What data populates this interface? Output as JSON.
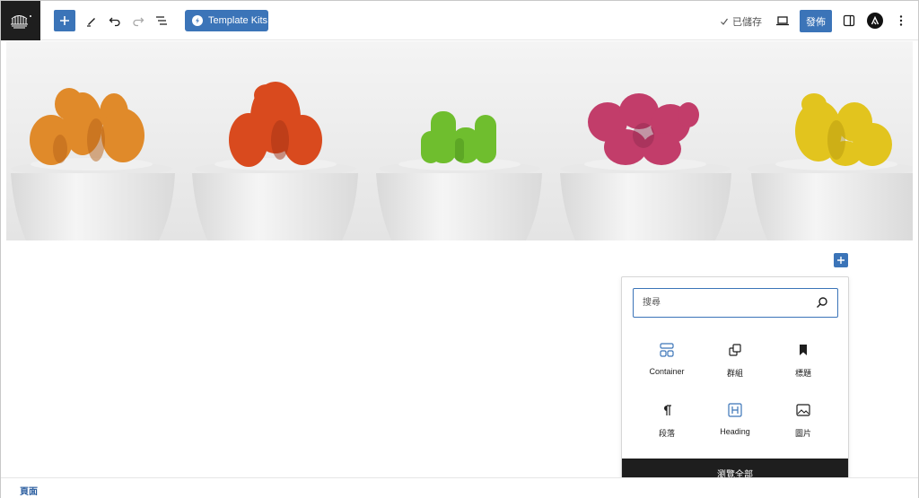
{
  "toolbar": {
    "template_kits_label": "Template Kits",
    "saved_label": "已儲存",
    "publish_label": "發佈"
  },
  "inserter": {
    "search_placeholder": "搜尋",
    "blocks": [
      {
        "label": "Container",
        "icon": "container-icon"
      },
      {
        "label": "群組",
        "icon": "group-icon"
      },
      {
        "label": "標題",
        "icon": "bookmark-icon"
      },
      {
        "label": "段落",
        "icon": "paragraph-icon"
      },
      {
        "label": "Heading",
        "icon": "heading-icon"
      },
      {
        "label": "圖片",
        "icon": "image-icon"
      }
    ],
    "browse_all_label": "瀏覽全部"
  },
  "footer": {
    "breadcrumb_label": "頁面"
  },
  "colors": {
    "accent": "#3b74b8",
    "dark": "#1e1e1e",
    "cactus_orange": "#e08a2a",
    "cactus_red": "#d94a1e",
    "cactus_green": "#6fbe2e",
    "cactus_pink": "#c23d6a",
    "cactus_yellow": "#e2c41e"
  }
}
